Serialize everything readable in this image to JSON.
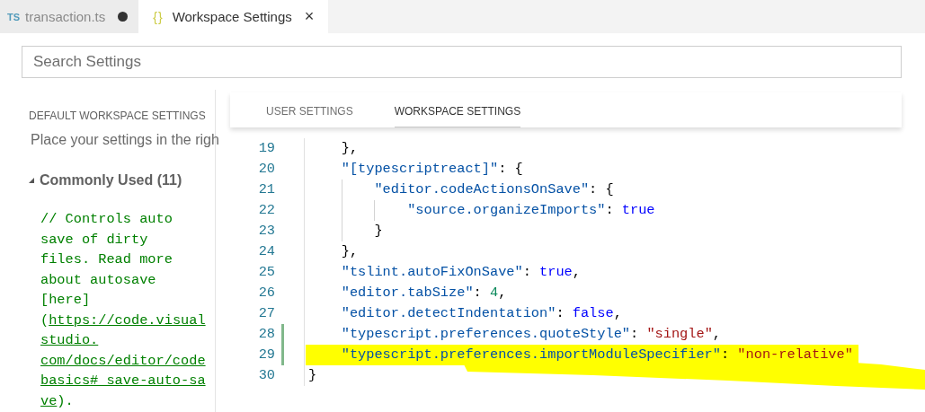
{
  "tabs": [
    {
      "icon": "TS",
      "color": "#519aba",
      "label": "transaction.ts",
      "selected": false,
      "dirty": true
    },
    {
      "icon": "{}",
      "color": "#cbcb41",
      "label": "Workspace Settings",
      "selected": true,
      "dirty": false,
      "close": "×"
    }
  ],
  "search": {
    "placeholder": "Search Settings"
  },
  "default_settings": {
    "header": "DEFAULT WORKSPACE SETTINGS",
    "hint": "Place your settings in the righ",
    "section": {
      "label": "Commonly Used (11)",
      "expanded": true
    },
    "comment_lines": [
      [
        {
          "text": "// Controls auto",
          "kind": "text"
        }
      ],
      [
        {
          "text": "save of dirty",
          "kind": "text"
        }
      ],
      [
        {
          "text": "files. Read more",
          "kind": "text"
        }
      ],
      [
        {
          "text": "about autosave",
          "kind": "text"
        }
      ],
      [
        {
          "text": "[here]",
          "kind": "text"
        }
      ],
      [
        {
          "text": "(",
          "kind": "text"
        },
        {
          "text": "https://code.visual",
          "kind": "link"
        }
      ],
      [
        {
          "text": "studio.",
          "kind": "link"
        }
      ],
      [
        {
          "text": "com/docs/editor/code",
          "kind": "link"
        }
      ],
      [
        {
          "text": "basics#_save-auto-sa",
          "kind": "link"
        }
      ],
      [
        {
          "text": "ve",
          "kind": "link"
        },
        {
          "text": ").",
          "kind": "text"
        }
      ]
    ]
  },
  "settings_tabs": [
    {
      "label": "USER SETTINGS",
      "selected": false
    },
    {
      "label": "WORKSPACE SETTINGS",
      "selected": true
    }
  ],
  "editor_lines": [
    {
      "number": "19",
      "modified": false,
      "highlighted": false,
      "tokens": [
        {
          "text": "    },",
          "kind": "punct"
        }
      ]
    },
    {
      "number": "20",
      "modified": false,
      "highlighted": false,
      "tokens": [
        {
          "text": "    \"[typescriptreact]\"",
          "kind": "key"
        },
        {
          "text": ": {",
          "kind": "punct"
        }
      ]
    },
    {
      "number": "21",
      "modified": false,
      "highlighted": false,
      "tokens": [
        {
          "text": "        \"editor.codeActionsOnSave\"",
          "kind": "key"
        },
        {
          "text": ": {",
          "kind": "punct"
        }
      ]
    },
    {
      "number": "22",
      "modified": false,
      "highlighted": false,
      "tokens": [
        {
          "text": "            \"source.organizeImports\"",
          "kind": "key"
        },
        {
          "text": ": ",
          "kind": "punct"
        },
        {
          "text": "true",
          "kind": "bool"
        }
      ]
    },
    {
      "number": "23",
      "modified": false,
      "highlighted": false,
      "tokens": [
        {
          "text": "        }",
          "kind": "punct"
        }
      ]
    },
    {
      "number": "24",
      "modified": false,
      "highlighted": false,
      "tokens": [
        {
          "text": "    },",
          "kind": "punct"
        }
      ]
    },
    {
      "number": "25",
      "modified": false,
      "highlighted": false,
      "tokens": [
        {
          "text": "    \"tslint.autoFixOnSave\"",
          "kind": "key"
        },
        {
          "text": ": ",
          "kind": "punct"
        },
        {
          "text": "true",
          "kind": "bool"
        },
        {
          "text": ",",
          "kind": "punct"
        }
      ]
    },
    {
      "number": "26",
      "modified": false,
      "highlighted": false,
      "tokens": [
        {
          "text": "    \"editor.tabSize\"",
          "kind": "key"
        },
        {
          "text": ": ",
          "kind": "punct"
        },
        {
          "text": "4",
          "kind": "number"
        },
        {
          "text": ",",
          "kind": "punct"
        }
      ]
    },
    {
      "number": "27",
      "modified": false,
      "highlighted": false,
      "tokens": [
        {
          "text": "    \"editor.detectIndentation\"",
          "kind": "key"
        },
        {
          "text": ": ",
          "kind": "punct"
        },
        {
          "text": "false",
          "kind": "bool"
        },
        {
          "text": ",",
          "kind": "punct"
        }
      ]
    },
    {
      "number": "28",
      "modified": true,
      "highlighted": false,
      "tokens": [
        {
          "text": "    \"typescript.preferences.quoteStyle\"",
          "kind": "key"
        },
        {
          "text": ": ",
          "kind": "punct"
        },
        {
          "text": "\"single\"",
          "kind": "string"
        },
        {
          "text": ",",
          "kind": "punct"
        }
      ]
    },
    {
      "number": "29",
      "modified": true,
      "highlighted": true,
      "tokens": [
        {
          "text": "    \"typescript.preferences.importModuleSpecifier\"",
          "kind": "key"
        },
        {
          "text": ": ",
          "kind": "punct"
        },
        {
          "text": "\"non-relative\"",
          "kind": "string"
        }
      ]
    },
    {
      "number": "30",
      "modified": false,
      "highlighted": false,
      "tokens": [
        {
          "text": "}",
          "kind": "punct"
        }
      ]
    }
  ]
}
